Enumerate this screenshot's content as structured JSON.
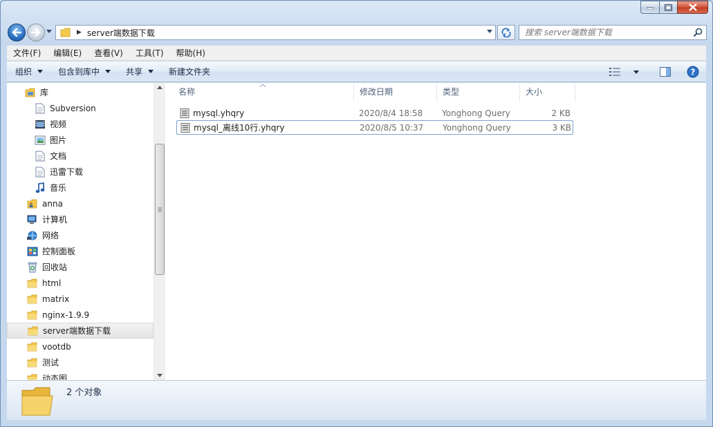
{
  "address": {
    "path_segment": "server端数据下载",
    "search_placeholder": "搜索 server端数据下载"
  },
  "menu": [
    "文件(F)",
    "编辑(E)",
    "查看(V)",
    "工具(T)",
    "帮助(H)"
  ],
  "commands": {
    "organize": "组织",
    "include_library": "包含到库中",
    "share": "共享",
    "new_folder": "新建文件夹"
  },
  "nav_tree": [
    {
      "label": "库",
      "icon": "library-icon"
    },
    {
      "label": "Subversion",
      "icon": "document-icon"
    },
    {
      "label": "视频",
      "icon": "video-icon"
    },
    {
      "label": "图片",
      "icon": "picture-icon"
    },
    {
      "label": "文档",
      "icon": "document-icon"
    },
    {
      "label": "迅雷下载",
      "icon": "document-icon"
    },
    {
      "label": "音乐",
      "icon": "music-icon"
    },
    {
      "label": "anna",
      "icon": "user-folder-icon"
    },
    {
      "label": "计算机",
      "icon": "computer-icon"
    },
    {
      "label": "网络",
      "icon": "network-icon"
    },
    {
      "label": "控制面板",
      "icon": "control-panel-icon"
    },
    {
      "label": "回收站",
      "icon": "recycle-bin-icon"
    },
    {
      "label": "html",
      "icon": "folder-icon"
    },
    {
      "label": "matrix",
      "icon": "folder-icon"
    },
    {
      "label": "nginx-1.9.9",
      "icon": "folder-icon"
    },
    {
      "label": "server端数据下载",
      "icon": "folder-icon",
      "selected": true
    },
    {
      "label": "vootdb",
      "icon": "folder-icon"
    },
    {
      "label": "测试",
      "icon": "folder-icon"
    },
    {
      "label": "动态图",
      "icon": "folder-icon"
    }
  ],
  "columns": {
    "name": "名称",
    "date": "修改日期",
    "type": "类型",
    "size": "大小"
  },
  "files": [
    {
      "name": "mysql.yhqry",
      "date": "2020/8/4 18:58",
      "type": "Yonghong Query",
      "size": "2 KB"
    },
    {
      "name": "mysql_离线10行.yhqry",
      "date": "2020/8/5 10:37",
      "type": "Yonghong Query",
      "size": "3 KB"
    }
  ],
  "details": {
    "count_text": "2 个对象"
  },
  "colors": {
    "window_frame": "#c5d8ee",
    "close_button": "#c23c22",
    "folder_yellow": "#f2c94c"
  }
}
